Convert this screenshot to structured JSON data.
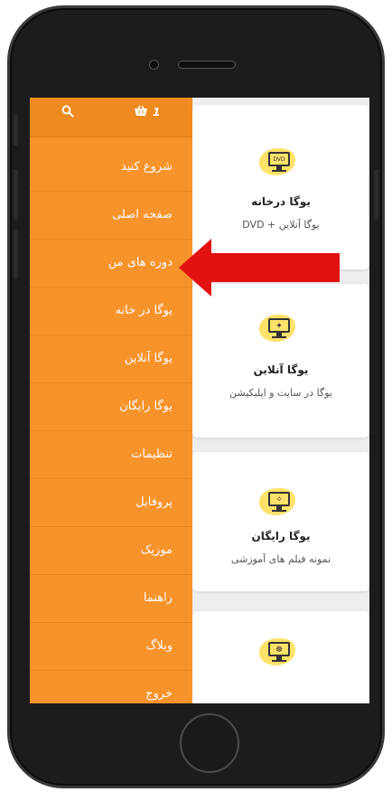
{
  "header": {
    "cart_count": "1",
    "search_icon": "search-icon",
    "cart_icon": "cart-icon"
  },
  "menu": {
    "items": [
      {
        "label": "شروع کنید"
      },
      {
        "label": "صفحه اصلی"
      },
      {
        "label": "دوره های من"
      },
      {
        "label": "یوگا در خانه"
      },
      {
        "label": "یوگا آنلاین"
      },
      {
        "label": "یوگا رایگان"
      },
      {
        "label": "تنظیمات"
      },
      {
        "label": "پروفایل"
      },
      {
        "label": "موزیک"
      },
      {
        "label": "راهنما"
      },
      {
        "label": "وبلاگ"
      },
      {
        "label": "خروج"
      }
    ]
  },
  "cards": [
    {
      "title": "یوگا درخانه",
      "subtitle": "یوگا آنلاین + DVD",
      "icon": "dvd-monitor-icon",
      "glyph": "DVD"
    },
    {
      "title": "یوگا آنلاین",
      "subtitle": "یوگا در سایت و اپلیکیشن",
      "icon": "yoga-pose-monitor-icon",
      "glyph": "✦"
    },
    {
      "title": "یوگا رایگان",
      "subtitle": "نمونه فیلم های آموزشی",
      "icon": "yoga-stand-monitor-icon",
      "glyph": "✧"
    },
    {
      "title": "",
      "subtitle": "",
      "icon": "meditation-monitor-icon",
      "glyph": "☸"
    }
  ],
  "colors": {
    "drawer_bg": "#f7932b",
    "drawer_header": "#ee8a1f",
    "arrow": "#e31212",
    "icon_blob": "#ffe26a"
  }
}
